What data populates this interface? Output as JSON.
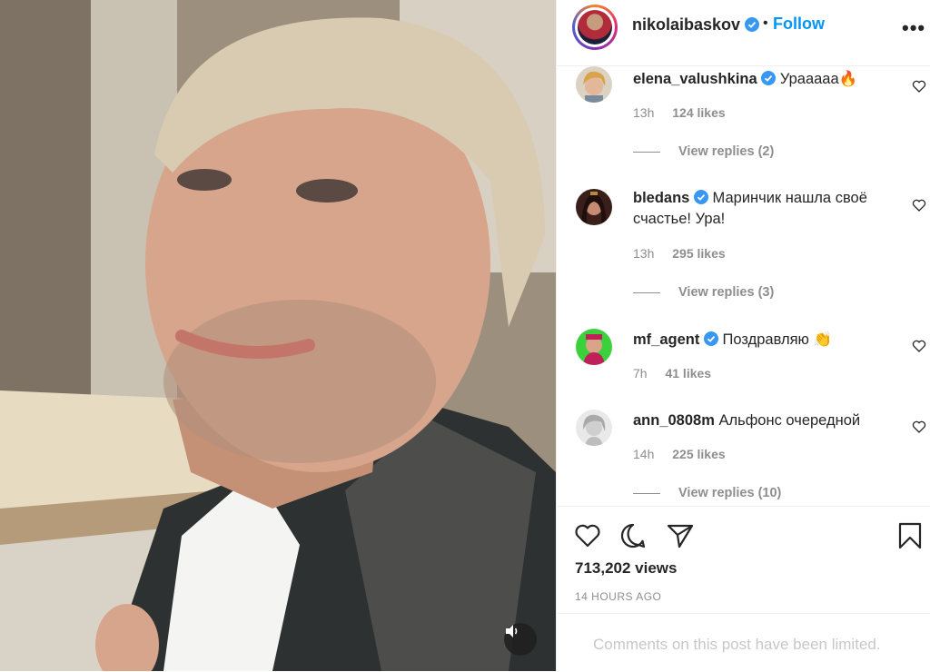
{
  "post": {
    "username": "nikolaibaskov",
    "follow_label": "Follow",
    "separator": "•",
    "more_label": "•••",
    "views": "713,202 views",
    "time_ago": "14 HOURS AGO",
    "limited_notice": "Comments on this post have been limited."
  },
  "comments": [
    {
      "username": "elena_valushkina",
      "verified": true,
      "text": "Урааааа🔥",
      "time": "13h",
      "likes": "124 likes",
      "replies": "View replies (2)"
    },
    {
      "username": "bledans",
      "verified": true,
      "text": "Маринчик нашла своё счастье! Ура!",
      "time": "13h",
      "likes": "295 likes",
      "replies": "View replies (3)"
    },
    {
      "username": "mf_agent",
      "verified": true,
      "text": "Поздравляю 👏",
      "time": "7h",
      "likes": "41 likes",
      "replies": ""
    },
    {
      "username": "ann_0808m",
      "verified": false,
      "text": "Альфонс очередной",
      "time": "14h",
      "likes": "225 likes",
      "replies": "View replies (10)"
    }
  ],
  "icons": {
    "like": "heart-icon",
    "comment": "comment-bubble-icon",
    "share": "paper-plane-icon",
    "save": "bookmark-icon",
    "sound": "speaker-icon",
    "verified": "verified-badge-icon"
  },
  "colors": {
    "accent": "#0095f6",
    "muted": "#8e8e8e",
    "verified": "#3897f0"
  }
}
